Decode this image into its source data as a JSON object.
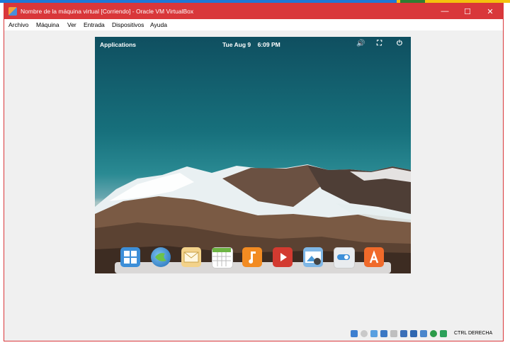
{
  "window": {
    "title": "Nombre de la máquina virtual [Corriendo] - Oracle VM VirtualBox",
    "minimize_glyph": "—",
    "maximize_glyph": "☐",
    "close_glyph": "✕"
  },
  "menu": [
    "Archivo",
    "Máquina",
    "Ver",
    "Entrada",
    "Dispositivos",
    "Ayuda"
  ],
  "guest": {
    "panel": {
      "applications_label": "Applications",
      "date": "Tue Aug 9",
      "time": "6:09 PM",
      "icons": [
        "volume-icon",
        "network-icon",
        "power-icon"
      ]
    },
    "dock_items": [
      "multitasking-view-icon",
      "web-browser-icon",
      "mail-icon",
      "calendar-icon",
      "music-icon",
      "videos-icon",
      "photos-icon",
      "settings-icon",
      "appcenter-icon"
    ]
  },
  "statusbar": {
    "host_key_label": "CTRL DERECHA",
    "icons": [
      "hard-disk-icon",
      "optical-drive-icon",
      "audio-icon",
      "network-adapter-icon",
      "usb-icon",
      "shared-folders-icon",
      "display-icon",
      "video-capture-icon",
      "virtualization-icon",
      "mouse-integration-icon"
    ]
  }
}
